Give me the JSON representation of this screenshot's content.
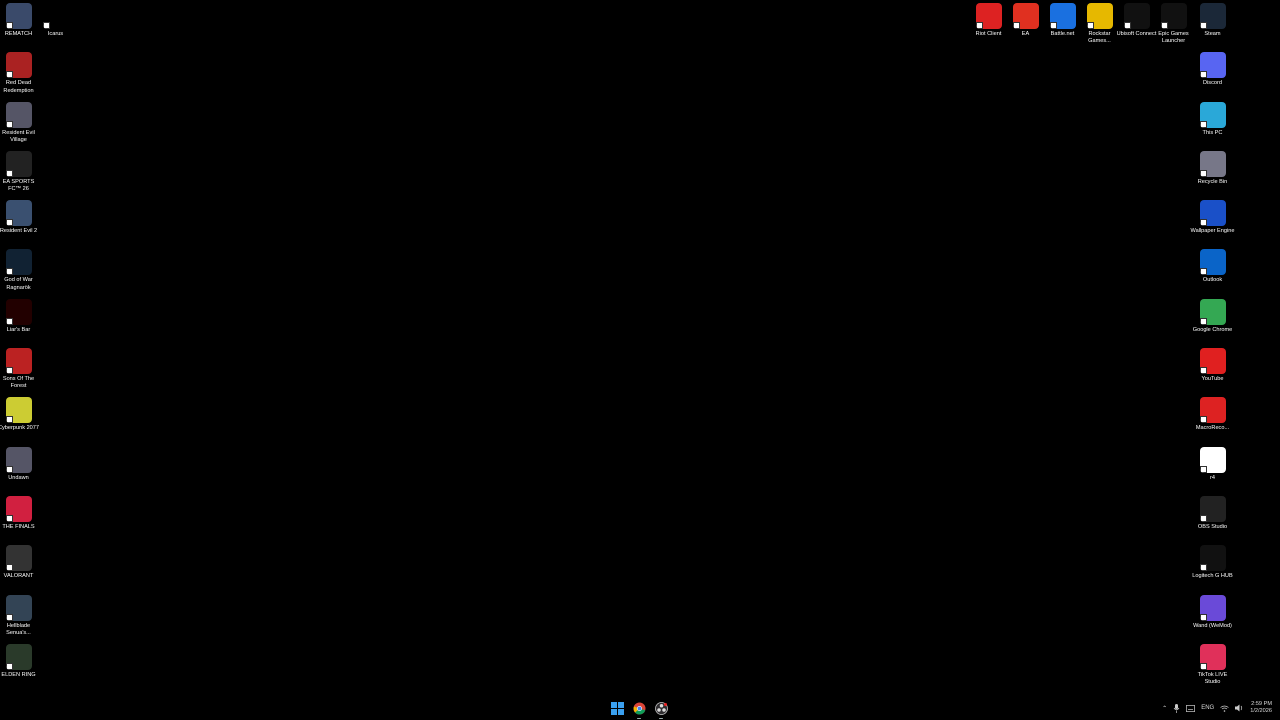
{
  "left_col1": [
    {
      "label": "REMATCH",
      "color": "#3a4a6a"
    },
    {
      "label": "Red Dead Redemption",
      "color": "#a22"
    },
    {
      "label": "Resident Evil Village",
      "color": "#556"
    },
    {
      "label": "EA SPORTS FC™ 26",
      "color": "#222"
    },
    {
      "label": "Resident Evil 2",
      "color": "#3a5070"
    },
    {
      "label": "God of War Ragnarök",
      "color": "#123"
    },
    {
      "label": "Liar's Bar",
      "color": "#200"
    },
    {
      "label": "Sons Of The Forest",
      "color": "#b22"
    },
    {
      "label": "Cyberpunk 2077",
      "color": "#cc3"
    },
    {
      "label": "Undawn",
      "color": "#556"
    },
    {
      "label": "THE FINALS",
      "color": "#d12040"
    },
    {
      "label": "VALORANT",
      "color": "#333"
    },
    {
      "label": "Hellblade Senua's...",
      "color": "#345"
    },
    {
      "label": "ELDEN RING",
      "color": "#2a3a2a"
    }
  ],
  "left_col2": [
    {
      "label": "Icarus",
      "color": "#000"
    }
  ],
  "right_row": [
    {
      "label": "Riot Client",
      "color": "#d22"
    },
    {
      "label": "EA",
      "color": "#e03020"
    },
    {
      "label": "Battle.net",
      "color": "#1a70e0"
    },
    {
      "label": "Rockstar Games...",
      "color": "#e6b800"
    },
    {
      "label": "Ubisoft Connect",
      "color": "#111"
    },
    {
      "label": "Epic Games Launcher",
      "color": "#111"
    }
  ],
  "right_col": [
    {
      "label": "Steam",
      "color": "#1b2838"
    },
    {
      "label": "Discord",
      "color": "#5865f2"
    },
    {
      "label": "This PC",
      "color": "#2aa8d8"
    },
    {
      "label": "Recycle Bin",
      "color": "#778"
    },
    {
      "label": "Wallpaper Engine",
      "color": "#1a50c8"
    },
    {
      "label": "Outlook",
      "color": "#0a64c8"
    },
    {
      "label": "Google Chrome",
      "color": "#34a853"
    },
    {
      "label": "YouTube",
      "color": "#e02020"
    },
    {
      "label": "MacroReco...",
      "color": "#d22"
    },
    {
      "label": "r4",
      "color": "#fff"
    },
    {
      "label": "OBS Studio",
      "color": "#222"
    },
    {
      "label": "Logitech G HUB",
      "color": "#111"
    },
    {
      "label": "Wand (WeMod)",
      "color": "#6a4ad8"
    },
    {
      "label": "TikTok LIVE Studio",
      "color": "#e0305a"
    }
  ],
  "taskbar": {
    "apps": [
      "windows-start",
      "google-chrome",
      "obs-studio"
    ],
    "tray_lang": "ENG",
    "time": "2:59 PM",
    "date": "1/2/2026"
  }
}
